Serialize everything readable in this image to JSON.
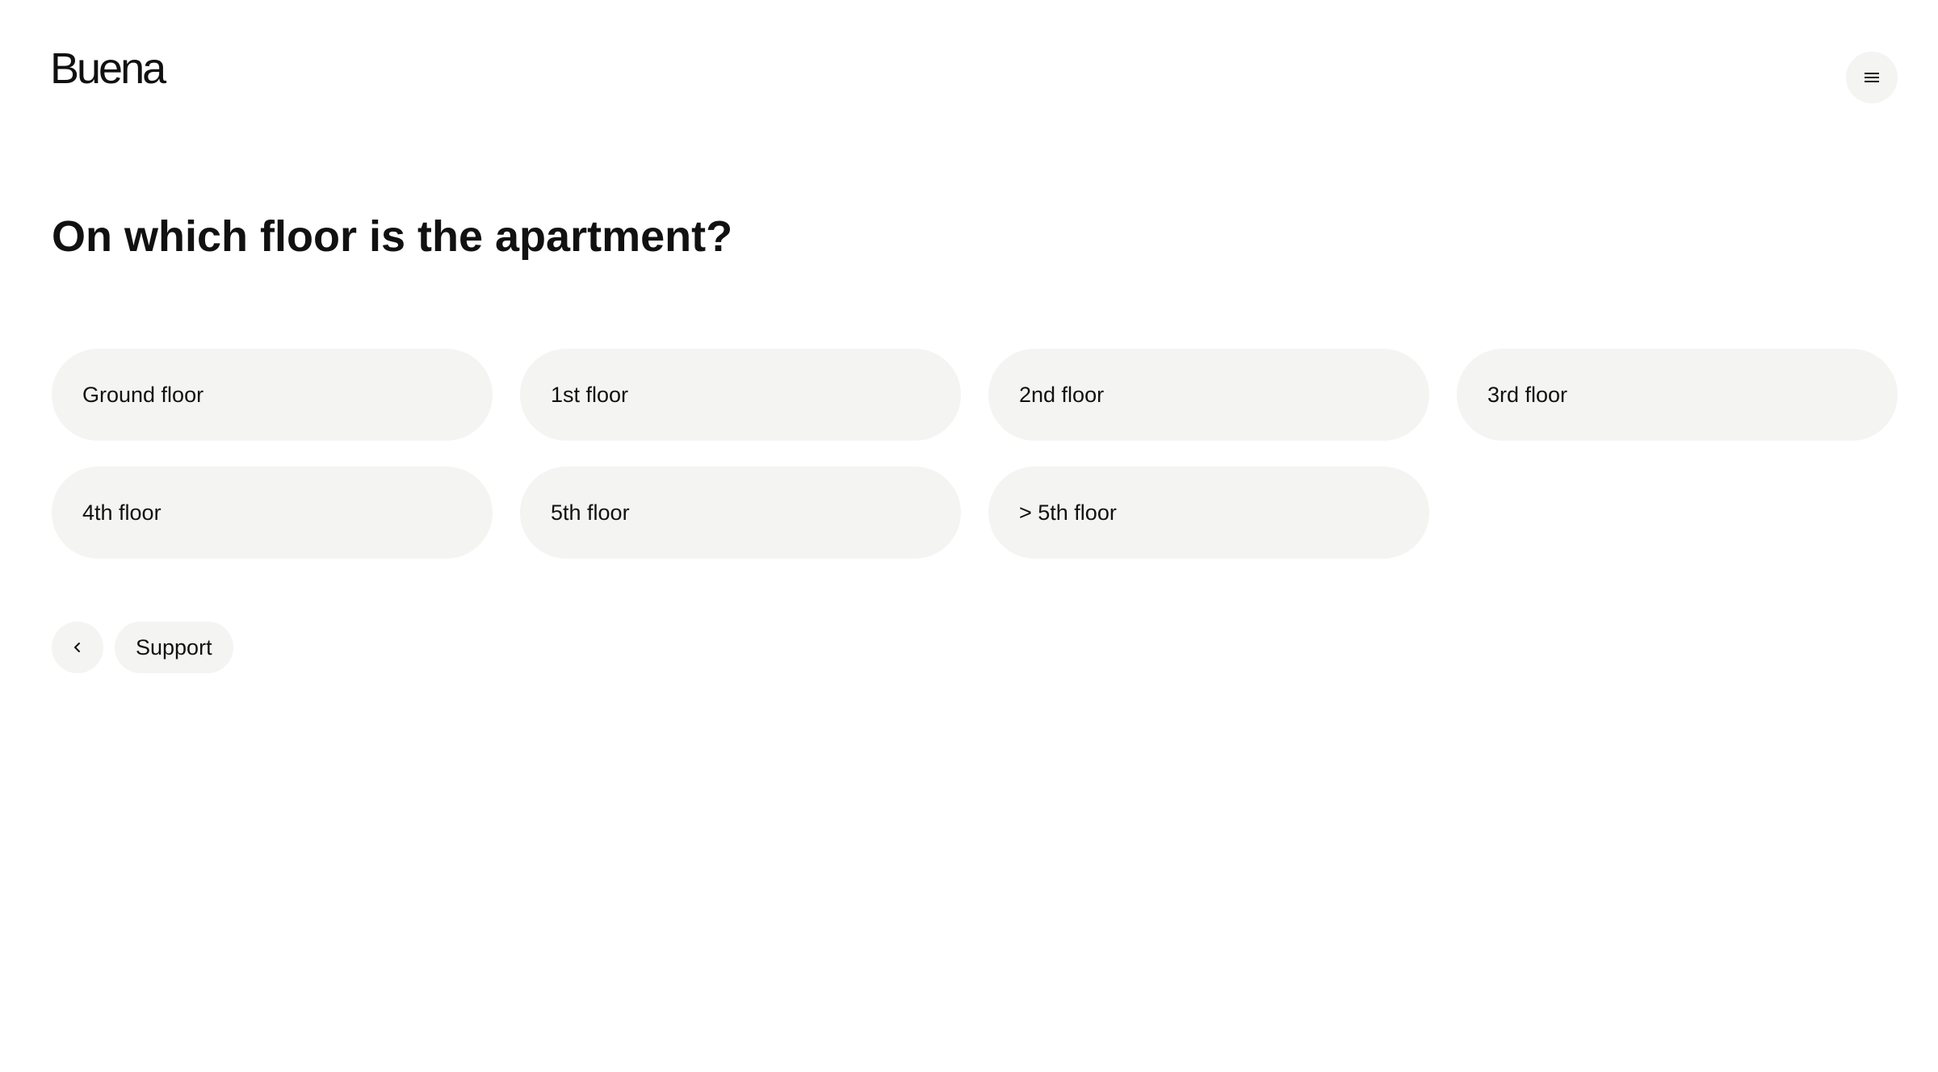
{
  "header": {
    "logo_text": "Buena",
    "menu_icon": "hamburger-menu-icon"
  },
  "main": {
    "question": "On which floor is the apartment?",
    "options": [
      {
        "label": "Ground floor"
      },
      {
        "label": "1st floor"
      },
      {
        "label": "2nd floor"
      },
      {
        "label": "3rd floor"
      },
      {
        "label": "4th floor"
      },
      {
        "label": "5th floor"
      },
      {
        "label": "> 5th floor"
      }
    ]
  },
  "footer_nav": {
    "back_icon": "chevron-left-icon",
    "support_label": "Support"
  },
  "colors": {
    "background": "#ffffff",
    "surface": "#f4f4f2",
    "text": "#111111"
  }
}
